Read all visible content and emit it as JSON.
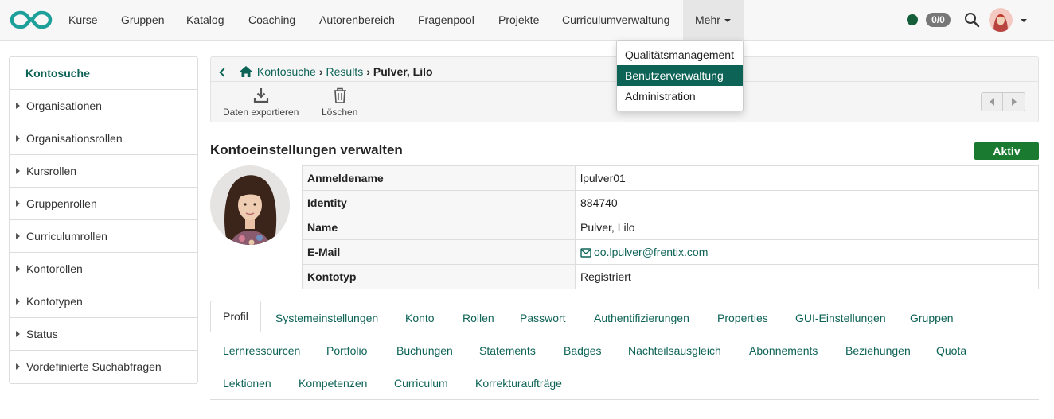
{
  "nav": {
    "items": [
      "Kurse",
      "Gruppen",
      "Katalog",
      "Coaching",
      "Autorenbereich",
      "Fragenpool",
      "Projekte",
      "Curriculumverwaltung"
    ],
    "more_label": "Mehr",
    "badge": "0/0",
    "status_color": "#145e3a"
  },
  "dropdown": {
    "items": [
      "Qualitätsmanagement",
      "Benutzerverwaltung",
      "Administration"
    ],
    "active_index": 1
  },
  "sidebar": {
    "header": "Kontosuche",
    "items": [
      "Organisationen",
      "Organisationsrollen",
      "Kursrollen",
      "Gruppenrollen",
      "Curriculumrollen",
      "Kontorollen",
      "Kontotypen",
      "Status",
      "Vordefinierte Suchabfragen"
    ]
  },
  "breadcrumb": {
    "items": [
      "Kontosuche",
      "Results"
    ],
    "current": "Pulver, Lilo"
  },
  "toolbar": {
    "export_label": "Daten exportieren",
    "delete_label": "Löschen"
  },
  "page": {
    "title": "Kontoeinstellungen verwalten",
    "status": "Aktiv",
    "status_color": "#1a7a2f"
  },
  "account": {
    "rows": [
      {
        "key": "Anmeldename",
        "value": "lpulver01"
      },
      {
        "key": "Identity",
        "value": "884740"
      },
      {
        "key": "Name",
        "value": "Pulver, Lilo"
      },
      {
        "key": "E-Mail",
        "value": "oo.lpulver@frentix.com"
      },
      {
        "key": "Kontotyp",
        "value": "Registriert"
      }
    ]
  },
  "tabs": {
    "row1": [
      "Profil",
      "Systemeinstellungen",
      "Konto",
      "Rollen",
      "Passwort",
      "Authentifizierungen",
      "Properties",
      "GUI-Einstellungen",
      "Gruppen"
    ],
    "row2": [
      "Lernressourcen",
      "Portfolio",
      "Buchungen",
      "Statements",
      "Badges",
      "Nachteilsausgleich",
      "Abonnements",
      "Beziehungen",
      "Quota"
    ],
    "row3": [
      "Lektionen",
      "Kompetenzen",
      "Curriculum",
      "Korrekturaufträge"
    ],
    "active": "Profil"
  },
  "colors": {
    "accent": "#0e6357",
    "brand_logo": "#1ea09a"
  }
}
